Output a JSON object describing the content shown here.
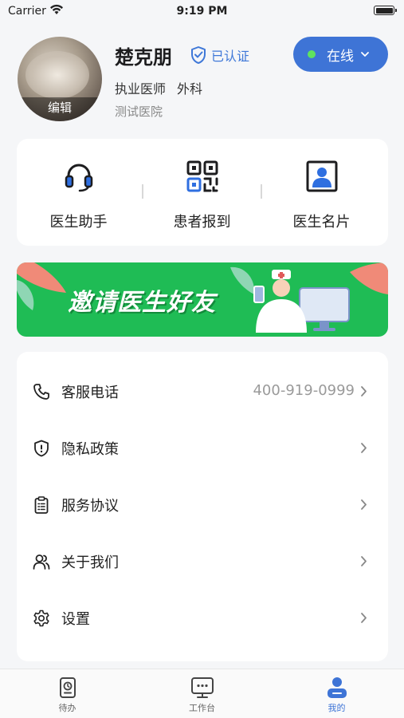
{
  "status_bar": {
    "carrier": "Carrier",
    "time": "9:19 PM"
  },
  "profile": {
    "edit_label": "编辑",
    "name": "楚克朋",
    "verified_label": "已认证",
    "title": "执业医师",
    "department": "外科",
    "hospital": "测试医院",
    "status": "在线",
    "status_color": "#5fe35f",
    "accent": "#3e74d6"
  },
  "quick_actions": [
    {
      "label": "医生助手",
      "icon": "headset-icon"
    },
    {
      "label": "患者报到",
      "icon": "qr-code-icon"
    },
    {
      "label": "医生名片",
      "icon": "id-card-icon"
    }
  ],
  "banner": {
    "text": "邀请医生好友",
    "color": "#1fbc55"
  },
  "menu": [
    {
      "label": "客服电话",
      "value": "400-919-0999",
      "icon": "phone-icon"
    },
    {
      "label": "隐私政策",
      "value": "",
      "icon": "shield-icon"
    },
    {
      "label": "服务协议",
      "value": "",
      "icon": "clipboard-icon"
    },
    {
      "label": "关于我们",
      "value": "",
      "icon": "users-icon"
    },
    {
      "label": "设置",
      "value": "",
      "icon": "gear-icon"
    }
  ],
  "tabs": [
    {
      "label": "待办",
      "icon": "todo-icon",
      "active": false
    },
    {
      "label": "工作台",
      "icon": "workbench-icon",
      "active": false
    },
    {
      "label": "我的",
      "icon": "profile-icon",
      "active": true
    }
  ]
}
